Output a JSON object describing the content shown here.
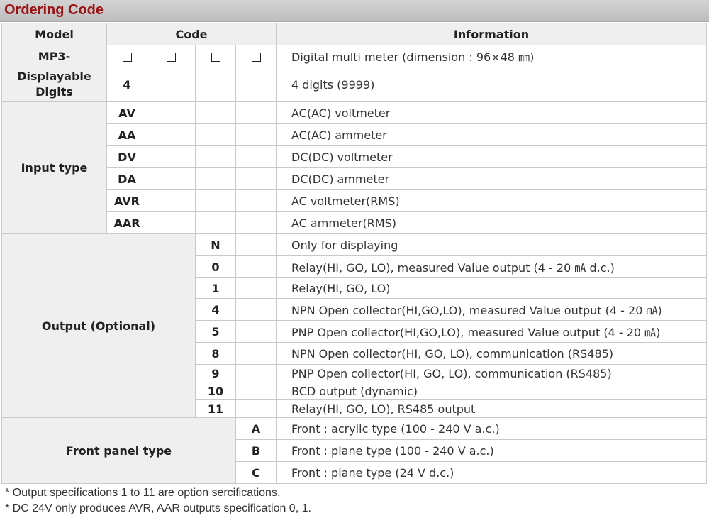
{
  "title": "Ordering Code",
  "headers": {
    "model": "Model",
    "code": "Code",
    "info": "Information"
  },
  "model_row": {
    "model": "MP3-",
    "info": "Digital multi meter (dimension : 96×48 ㎜)"
  },
  "digits_row": {
    "label": "Displayable\nDigits",
    "code": "4",
    "info": "4 digits (9999)"
  },
  "input_type": {
    "label": "Input type",
    "rows": [
      {
        "code": "AV",
        "info": "AC(AC) voltmeter"
      },
      {
        "code": "AA",
        "info": "AC(AC) ammeter"
      },
      {
        "code": "DV",
        "info": "DC(DC) voltmeter"
      },
      {
        "code": "DA",
        "info": "DC(DC) ammeter"
      },
      {
        "code": "AVR",
        "info": "AC voltmeter(RMS)"
      },
      {
        "code": "AAR",
        "info": "AC ammeter(RMS)"
      }
    ]
  },
  "output": {
    "label": "Output (Optional)",
    "rows": [
      {
        "code": "N",
        "info": "Only for displaying"
      },
      {
        "code": "0",
        "info": "Relay(HI, GO, LO), measured Value output (4 - 20 ㎃ d.c.)"
      },
      {
        "code": "1",
        "info": "Relay(HI, GO, LO)"
      },
      {
        "code": "4",
        "info": "NPN Open collector(HI,GO,LO), measured Value output (4 - 20 ㎃)"
      },
      {
        "code": "5",
        "info": "PNP Open collector(HI,GO,LO), measured Value output (4 - 20 ㎃)"
      },
      {
        "code": "8",
        "info": "NPN Open collector(HI, GO, LO), communication (RS485)"
      },
      {
        "code": "9",
        "info": "PNP Open collector(HI, GO, LO), communication (RS485)"
      },
      {
        "code": "10",
        "info": "BCD output (dynamic)"
      },
      {
        "code": "11",
        "info": "Relay(HI, GO, LO), RS485 output"
      }
    ]
  },
  "front_panel": {
    "label": "Front panel type",
    "rows": [
      {
        "code": "A",
        "info": "Front : acrylic type (100 - 240 V a.c.)"
      },
      {
        "code": "B",
        "info": "Front : plane type (100 - 240 V a.c.)"
      },
      {
        "code": "C",
        "info": "Front : plane type (24 V d.c.)"
      }
    ]
  },
  "notes": [
    "* Output specifications 1 to 11 are option sercifications.",
    "* DC 24V only produces AVR, AAR outputs specification 0, 1."
  ]
}
